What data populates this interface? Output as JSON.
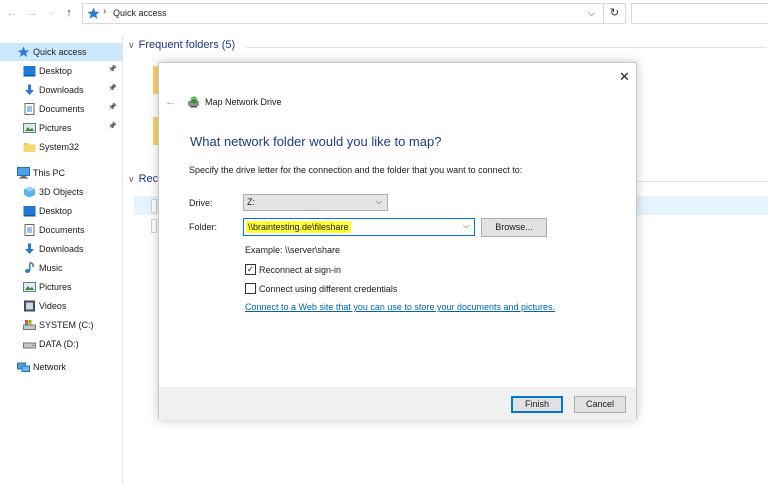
{
  "address_bar": {
    "path": "Quick access",
    "separator": "›"
  },
  "nav_pane": {
    "items": [
      {
        "label": "Quick access",
        "icon": "star-icon",
        "pinned": false,
        "selected": true,
        "indent": 0
      },
      {
        "label": "Desktop",
        "icon": "desktop-folder-icon",
        "pinned": true,
        "selected": false,
        "indent": 1
      },
      {
        "label": "Downloads",
        "icon": "downloads-arrow-icon",
        "pinned": true,
        "selected": false,
        "indent": 1
      },
      {
        "label": "Documents",
        "icon": "documents-icon",
        "pinned": true,
        "selected": false,
        "indent": 1
      },
      {
        "label": "Pictures",
        "icon": "pictures-icon",
        "pinned": true,
        "selected": false,
        "indent": 1
      },
      {
        "label": "System32",
        "icon": "folder-icon",
        "pinned": false,
        "selected": false,
        "indent": 1
      },
      {
        "label": "This PC",
        "icon": "computer-icon",
        "pinned": false,
        "selected": false,
        "indent": 0
      },
      {
        "label": "3D Objects",
        "icon": "3d-objects-icon",
        "pinned": false,
        "selected": false,
        "indent": 1
      },
      {
        "label": "Desktop",
        "icon": "desktop-folder-icon",
        "pinned": false,
        "selected": false,
        "indent": 1
      },
      {
        "label": "Documents",
        "icon": "documents-icon",
        "pinned": false,
        "selected": false,
        "indent": 1
      },
      {
        "label": "Downloads",
        "icon": "downloads-arrow-icon",
        "pinned": false,
        "selected": false,
        "indent": 1
      },
      {
        "label": "Music",
        "icon": "music-note-icon",
        "pinned": false,
        "selected": false,
        "indent": 1
      },
      {
        "label": "Pictures",
        "icon": "pictures-icon",
        "pinned": false,
        "selected": false,
        "indent": 1
      },
      {
        "label": "Videos",
        "icon": "videos-icon",
        "pinned": false,
        "selected": false,
        "indent": 1
      },
      {
        "label": "SYSTEM (C:)",
        "icon": "system-drive-icon",
        "pinned": false,
        "selected": false,
        "indent": 1
      },
      {
        "label": "DATA (D:)",
        "icon": "drive-icon",
        "pinned": false,
        "selected": false,
        "indent": 1
      },
      {
        "label": "Network",
        "icon": "network-icon",
        "pinned": false,
        "selected": false,
        "indent": 0
      }
    ]
  },
  "content": {
    "frequent_header": "Frequent folders (5)",
    "recent_header_partial": "Rec"
  },
  "dialog": {
    "window_title": "Map Network Drive",
    "heading": "What network folder would you like to map?",
    "description": "Specify the drive letter for the connection and the folder that you want to connect to:",
    "drive_label": "Drive:",
    "drive_value": "Z:",
    "folder_label": "Folder:",
    "folder_value": "\\\\braintesting.de\\fileshare",
    "browse_label": "Browse...",
    "example": "Example: \\\\server\\share",
    "reconnect_label": "Reconnect at sign-in",
    "reconnect_checked": true,
    "different_credentials_label": "Connect using different credentials",
    "different_credentials_checked": false,
    "web_link": "Connect to a Web site that you can use to store your documents and pictures.",
    "finish_label": "Finish",
    "cancel_label": "Cancel"
  },
  "colors": {
    "accent": "#0078d7",
    "heading_blue": "#1e3a8a",
    "selection": "#cce8ff",
    "highlight": "#ffff33"
  }
}
